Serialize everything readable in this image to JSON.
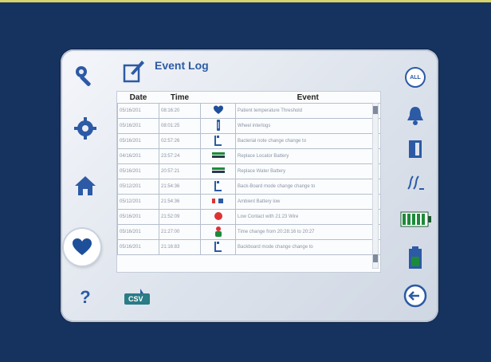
{
  "window": {
    "title": "Event Log"
  },
  "table": {
    "headers": [
      "Date",
      "Time",
      "",
      "Event"
    ],
    "rows": [
      {
        "date": "05/16/201",
        "time": "08:16:20",
        "icon": "heart-icon",
        "event": "Patient temperature Threshold"
      },
      {
        "date": "05/16/201",
        "time": "08:01:25",
        "icon": "syringe-icon",
        "event": "Wheel interlogs"
      },
      {
        "date": "05/16/201",
        "time": "02:57:26",
        "icon": "document-icon",
        "event": "Bacterial note change change to"
      },
      {
        "date": "04/16/201",
        "time": "23:57:24",
        "icon": "battery-icon",
        "event": "Replace Locator Battery"
      },
      {
        "date": "05/16/201",
        "time": "20:57:21",
        "icon": "battery-icon",
        "event": "Replace Water Battery"
      },
      {
        "date": "05/12/201",
        "time": "21:54:36",
        "icon": "document-icon",
        "event": "Back-Board mode change change to"
      },
      {
        "date": "05/12/201",
        "time": "21:54:36",
        "icon": "battery-small-icon",
        "event": "Ambient Battery low"
      },
      {
        "date": "05/16/201",
        "time": "21:52:09",
        "icon": "red-dot-icon",
        "event": "Low Contact with 21:23 Wire"
      },
      {
        "date": "05/16/201",
        "time": "21:27:00",
        "icon": "green-person-icon",
        "event": "Time change from 20:28:16 to 20:27"
      },
      {
        "date": "05/16/201",
        "time": "21:16:83",
        "icon": "document-icon",
        "event": "Backboard mode change change to"
      }
    ]
  },
  "left_nav": {
    "items": [
      {
        "name": "settings-wrench-icon"
      },
      {
        "name": "gear-icon"
      },
      {
        "name": "home-icon"
      },
      {
        "name": "heart-icon",
        "active": true
      },
      {
        "name": "help-icon",
        "label": "?"
      }
    ]
  },
  "right_nav": {
    "all_label": "ALL",
    "items": [
      "all-icon",
      "bell-icon",
      "door-icon",
      "wave-icon",
      "battery-full-icon",
      "battery-tall-icon",
      "back-arrow-icon"
    ]
  },
  "csv": {
    "label": "CSV"
  },
  "colors": {
    "background": "#16335f",
    "accent": "#2c5aa5",
    "heart": "#1e4f9a",
    "battery_green": "#1d8a3a"
  }
}
